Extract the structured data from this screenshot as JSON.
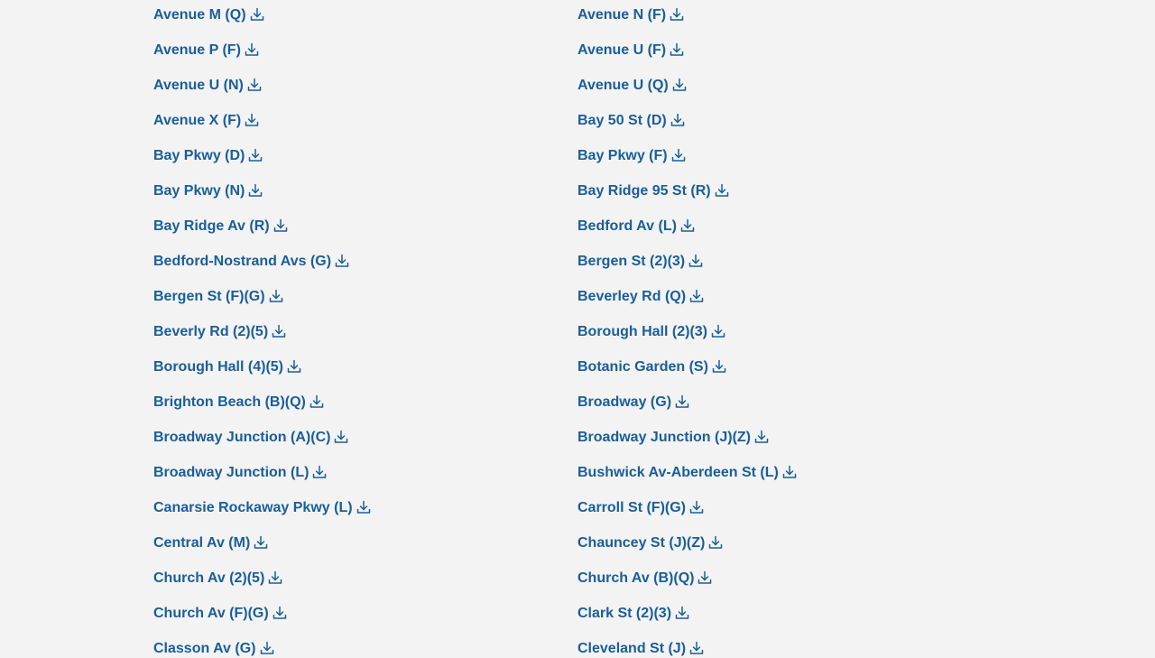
{
  "download_icon": "download-icon",
  "link_color": "#1a5e9a",
  "background": "#f3f3f3",
  "stations": [
    [
      "Avenue M (Q)",
      "Avenue N (F)"
    ],
    [
      "Avenue P (F)",
      "Avenue U (F)"
    ],
    [
      "Avenue U (N)",
      "Avenue U (Q)"
    ],
    [
      "Avenue X (F)",
      "Bay 50 St (D)"
    ],
    [
      "Bay Pkwy (D)",
      "Bay Pkwy (F)"
    ],
    [
      "Bay Pkwy (N)",
      "Bay Ridge 95 St (R)"
    ],
    [
      "Bay Ridge Av (R)",
      "Bedford Av (L)"
    ],
    [
      "Bedford-Nostrand Avs (G)",
      "Bergen St (2)(3)"
    ],
    [
      "Bergen St (F)(G)",
      "Beverley Rd (Q)"
    ],
    [
      "Beverly Rd (2)(5)",
      "Borough Hall (2)(3)"
    ],
    [
      "Borough Hall (4)(5)",
      "Botanic Garden (S)"
    ],
    [
      "Brighton Beach (B)(Q)",
      "Broadway (G)"
    ],
    [
      "Broadway Junction (A)(C)",
      "Broadway Junction (J)(Z)"
    ],
    [
      "Broadway Junction (L)",
      "Bushwick Av-Aberdeen St (L)"
    ],
    [
      "Canarsie Rockaway Pkwy (L)",
      "Carroll St (F)(G)"
    ],
    [
      "Central Av (M)",
      "Chauncey St (J)(Z)"
    ],
    [
      "Church Av (2)(5)",
      "Church Av (B)(Q)"
    ],
    [
      "Church Av (F)(G)",
      "Clark St (2)(3)"
    ],
    [
      "Classon Av (G)",
      "Cleveland St (J)"
    ]
  ]
}
